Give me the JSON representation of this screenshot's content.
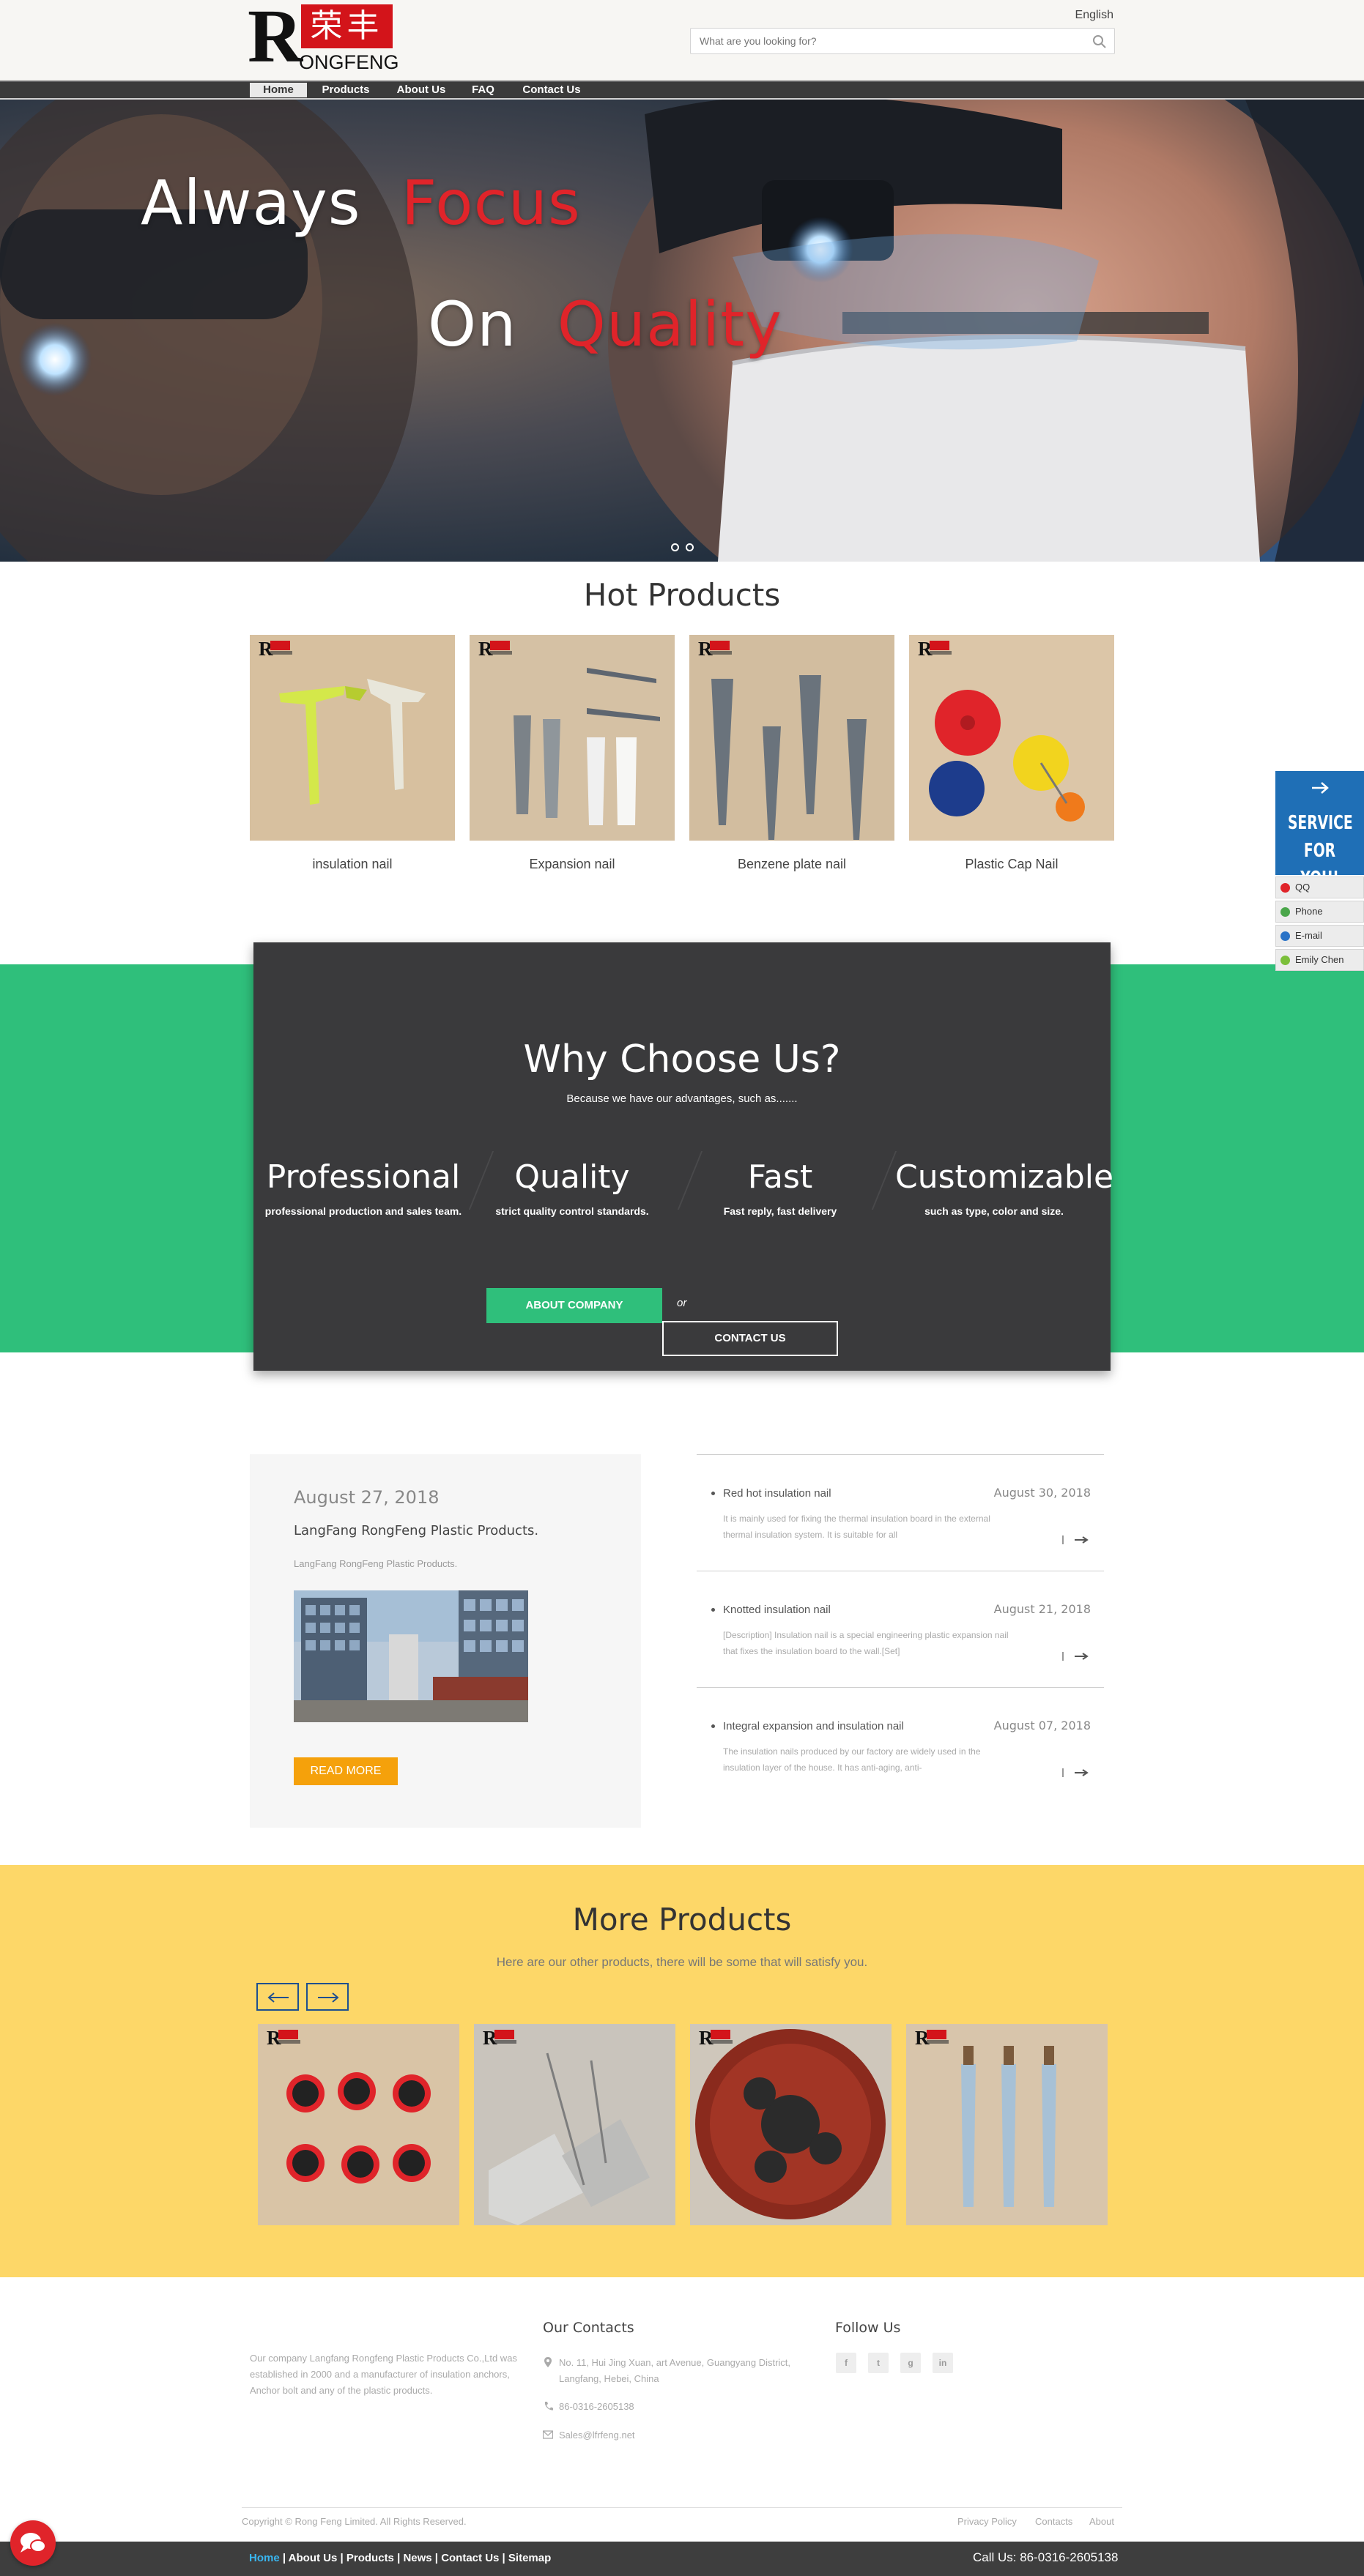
{
  "header": {
    "logo_letter": "R",
    "logo_chinese": "荣丰",
    "logo_text": "ONGFENG",
    "language": "English",
    "search_placeholder": "What are you looking for?"
  },
  "nav": [
    {
      "label": "Home",
      "active": true
    },
    {
      "label": "Products"
    },
    {
      "label": "About Us"
    },
    {
      "label": "FAQ"
    },
    {
      "label": "Contact Us"
    }
  ],
  "hero": {
    "line1_white": "Always",
    "line1_red": "Focus",
    "line2_white": "On",
    "line2_red": "Quality"
  },
  "hot_products": {
    "title": "Hot Products",
    "items": [
      {
        "name": "insulation nail"
      },
      {
        "name": "Expansion nail"
      },
      {
        "name": "Benzene plate nail"
      },
      {
        "name": "Plastic Cap Nail"
      }
    ]
  },
  "why": {
    "title": "Why Choose Us?",
    "subtitle": "Because we have our advantages, such as.......",
    "features": [
      {
        "title": "Professional",
        "desc": "professional production and sales team."
      },
      {
        "title": "Quality",
        "desc": "strict quality control standards."
      },
      {
        "title": "Fast",
        "desc": "Fast reply, fast delivery"
      },
      {
        "title": "Customizable",
        "desc": "such as type, color and size."
      }
    ],
    "about_button": "ABOUT COMPANY",
    "or": "or",
    "contact_button": "CONTACT US"
  },
  "news_featured": {
    "date": "August 27, 2018",
    "title": "LangFang RongFeng Plastic Products.",
    "desc": "LangFang RongFeng Plastic Products.",
    "read_more": "READ MORE"
  },
  "news_list": [
    {
      "title": "Red hot insulation nail",
      "date": "August 30, 2018",
      "desc": "It is mainly used for fixing the thermal insulation board in the external thermal insulation system. It is suitable for all"
    },
    {
      "title": "Knotted insulation nail",
      "date": "August 21, 2018",
      "desc": "[Description] Insulation nail is a special engineering plastic expansion nail that fixes the insulation board to the wall.[Set]"
    },
    {
      "title": "Integral expansion and insulation nail",
      "date": "August 07, 2018",
      "desc": "The insulation nails produced by our factory are widely used in the insulation layer of the house. It has anti-aging, anti-"
    }
  ],
  "more_products": {
    "title": "More Products",
    "subtitle": "Here are our other products, there will be some that will satisfy you."
  },
  "footer": {
    "about": "Our company Langfang Rongfeng Plastic Products Co.,Ltd was established in 2000 and a manufacturer of insulation anchors, Anchor bolt and any of the plastic products.",
    "contacts_title": "Our Contacts",
    "address": "No. 11, Hui Jing Xuan, art Avenue, Guangyang District, Langfang, Hebei, China",
    "phone": "86-0316-2605138",
    "email": "Sales@lfrfeng.net",
    "follow_title": "Follow Us",
    "copyright": "Copyright © Rong Feng Limited. All Rights Reserved.",
    "links": [
      "Privacy Policy",
      "Contacts",
      "About"
    ],
    "bottom_links": [
      "Home",
      "About Us",
      "Products",
      "News",
      "Contact Us",
      "Sitemap"
    ],
    "call": "Call Us: 86-0316-2605138"
  },
  "service": {
    "heading": "SERVICE FOR YOU!",
    "items": [
      {
        "label": "QQ"
      },
      {
        "label": "Phone"
      },
      {
        "label": "E-mail"
      },
      {
        "label": "Emily Chen"
      }
    ]
  },
  "colors": {
    "brand_red": "#d3141a",
    "green": "#2fbf7b",
    "yellow": "#fdd768",
    "dark": "#3a3a3c",
    "service_blue": "#1f6fb6",
    "read_more": "#f5a10b"
  },
  "icons": [
    "search-icon",
    "arrow-right-icon",
    "arrow-left-icon",
    "map-pin-icon",
    "phone-icon",
    "mail-icon",
    "facebook-icon",
    "twitter-icon",
    "google-plus-icon",
    "linkedin-icon",
    "chat-icon"
  ]
}
